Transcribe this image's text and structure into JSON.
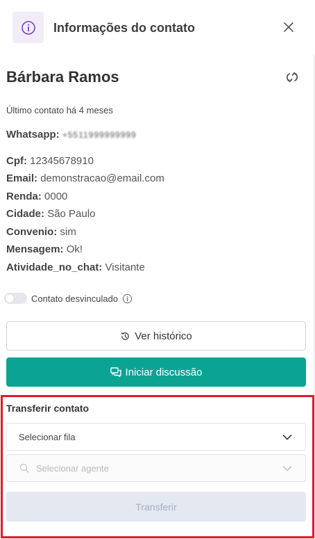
{
  "header": {
    "title": "Informações do contato",
    "info_icon": "info-circle-icon",
    "close_icon": "close-icon",
    "accent_color": "#7b3fbf"
  },
  "contact": {
    "name": "Bárbara Ramos",
    "last_contact": "Último contato há 4 meses",
    "fields": [
      {
        "key": "Whatsapp:",
        "value": "+5511999999999",
        "blurred": true
      },
      {
        "key": "Cpf:",
        "value": "12345678910"
      },
      {
        "key": "Email:",
        "value": "demonstracao@email.com"
      },
      {
        "key": "Renda:",
        "value": "0000"
      },
      {
        "key": "Cidade:",
        "value": "São Paulo"
      },
      {
        "key": "Convenio:",
        "value": "sim"
      },
      {
        "key": "Mensagem:",
        "value": "Ok!"
      },
      {
        "key": "Atividade_no_chat:",
        "value": "Visitante"
      }
    ]
  },
  "toggle": {
    "label": "Contato desvinculado",
    "on": false
  },
  "actions": {
    "history_label": "Ver histórico",
    "discussion_label": "Iniciar discussão",
    "primary_color": "#0ba493"
  },
  "transfer": {
    "title": "Transferir contato",
    "queue_placeholder": "Selecionar fila",
    "agent_placeholder": "Selecionar agente",
    "button_label": "Transferir",
    "highlight_color": "#e01a2b"
  }
}
